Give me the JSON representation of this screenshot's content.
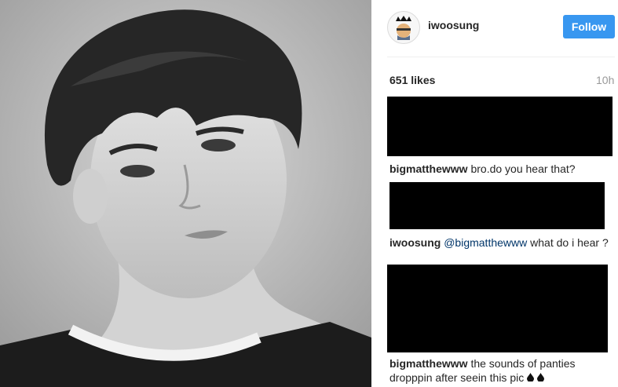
{
  "post": {
    "username": "iwoosung",
    "follow_label": "Follow",
    "likes": "651 likes",
    "time": "10h"
  },
  "comments": [
    {
      "user": "bigmatthewww",
      "text": "bro.do you hear that?"
    },
    {
      "user": "iwoosung",
      "mention": "@bigmatthewww",
      "text": "what do i hear ?"
    },
    {
      "user": "bigmatthewww",
      "text": "the sounds of panties dropppin after seein this pic"
    }
  ],
  "icons": {
    "avatar": "crown-avatar-icon",
    "emoji": "droplet-icon"
  },
  "colors": {
    "follow_button": "#3897f0",
    "mention": "#003569"
  }
}
